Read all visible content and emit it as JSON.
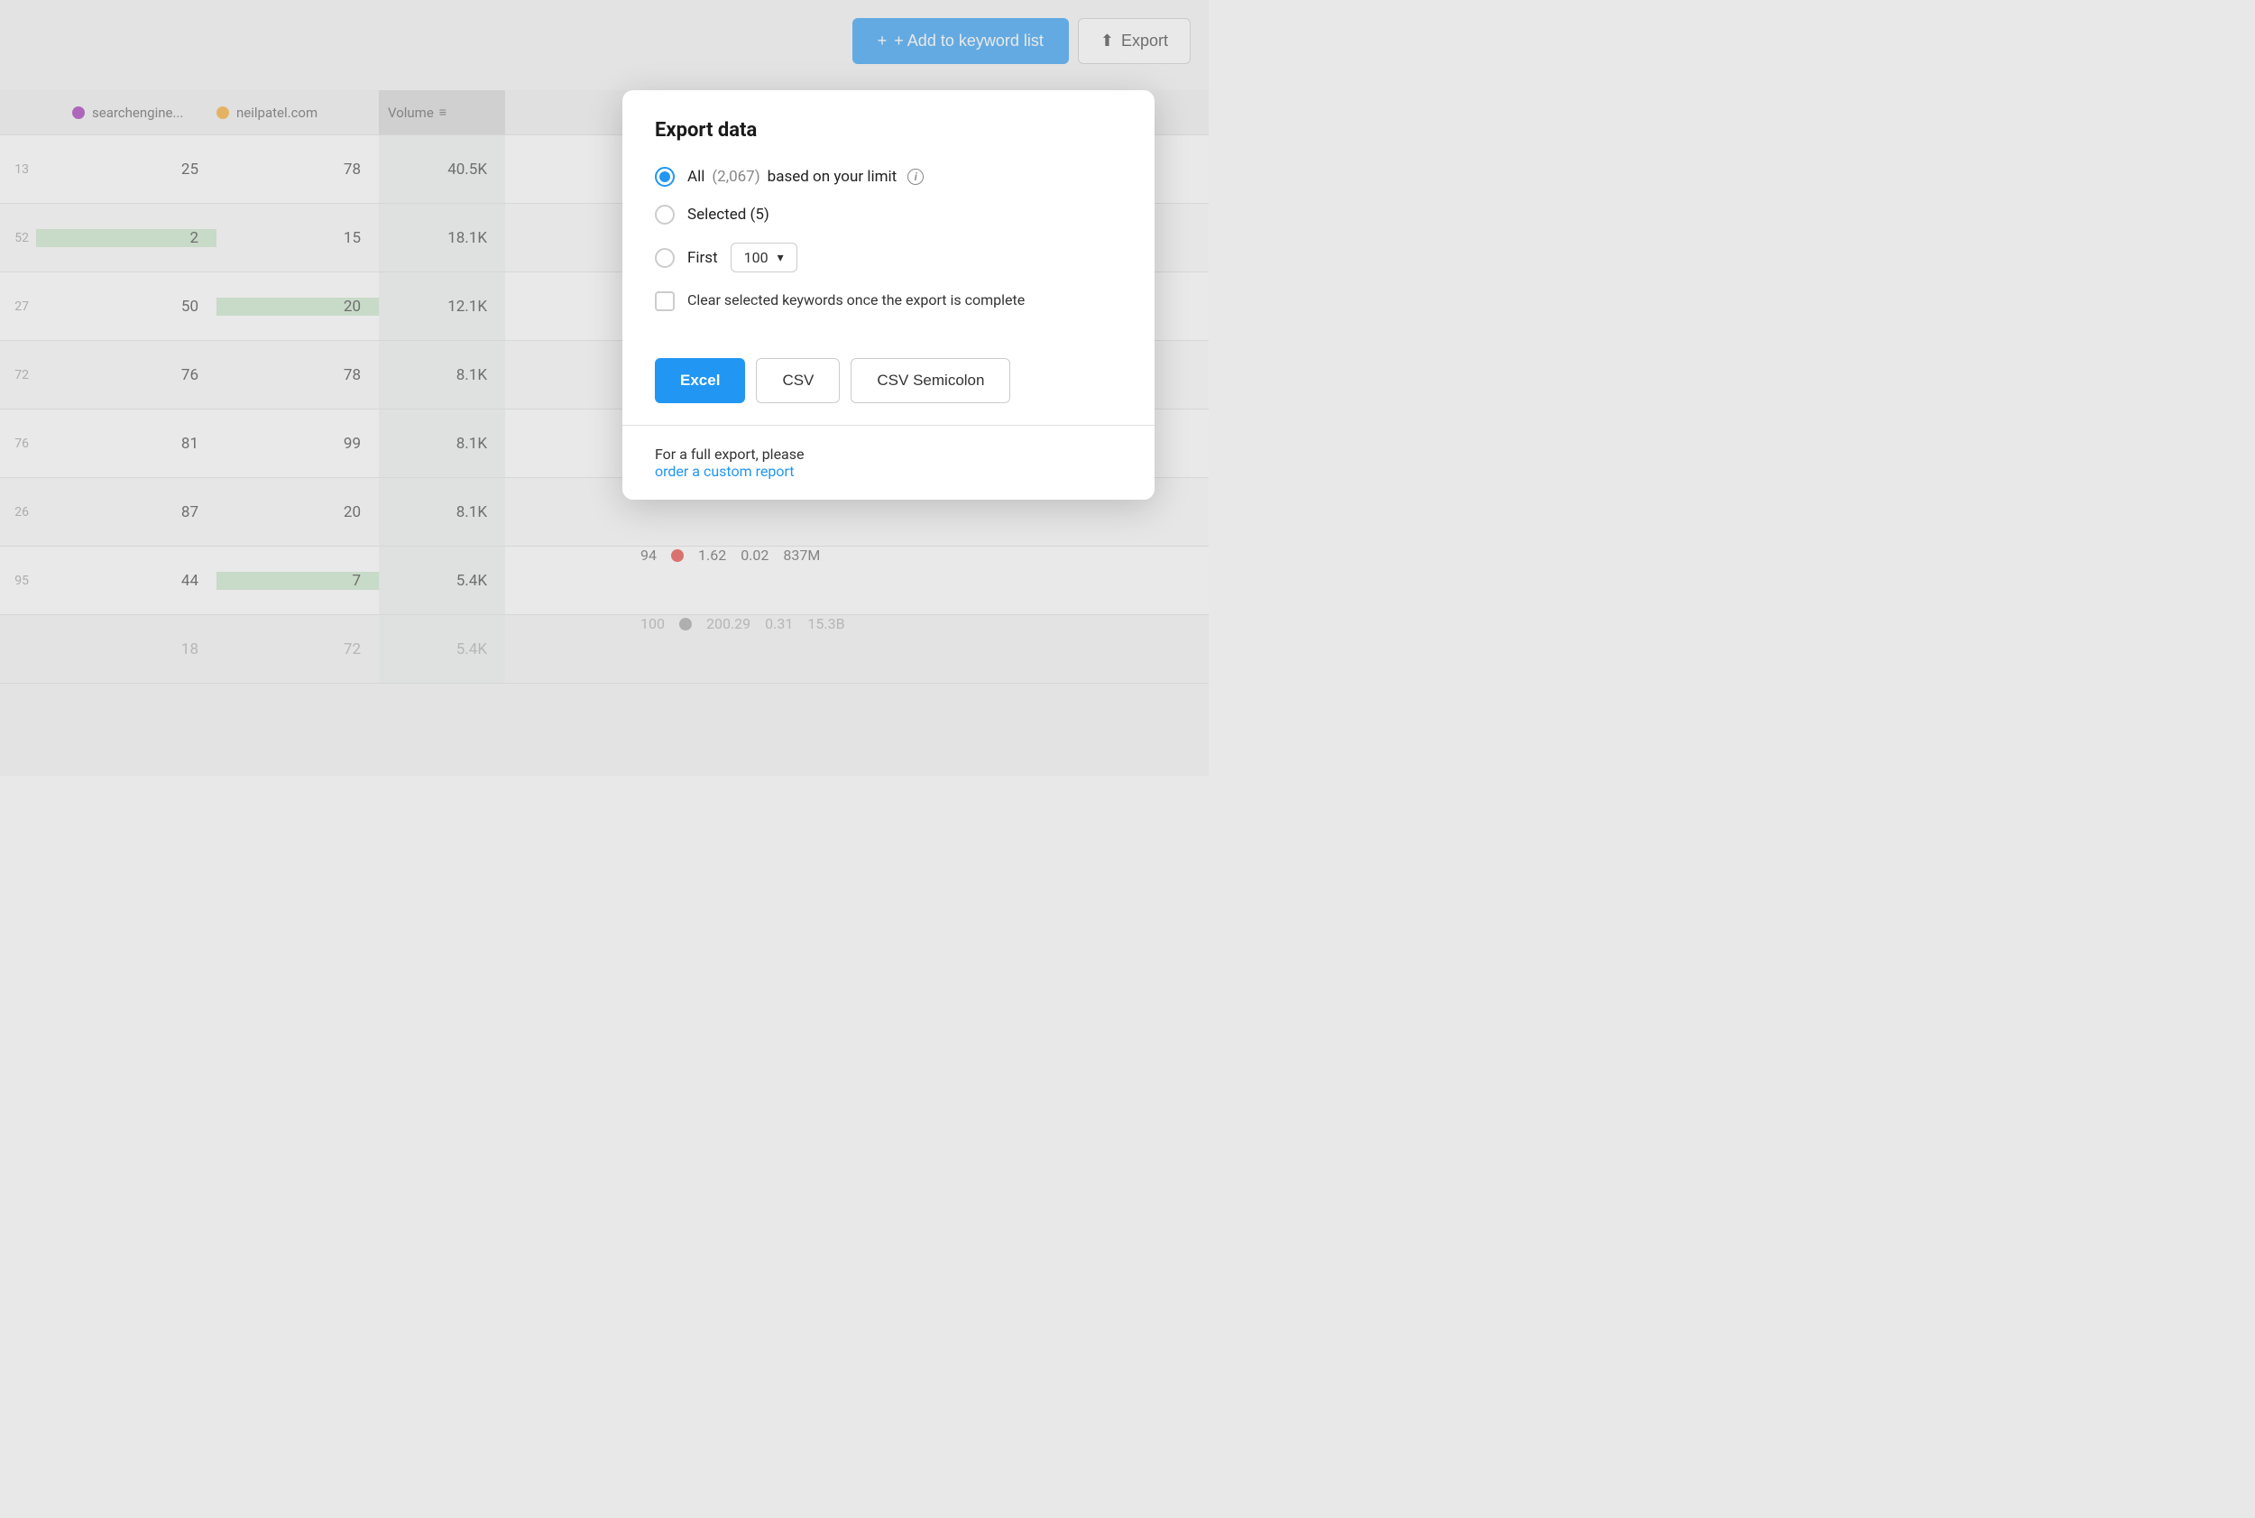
{
  "toolbar": {
    "add_keyword_label": "+ Add to keyword list",
    "export_label": "Export"
  },
  "table": {
    "columns": {
      "searchengine_label": "searchengine...",
      "neilpatel_label": "neilpatel.com",
      "volume_label": "Volume"
    },
    "rows": [
      {
        "num": "13",
        "se_val": "25",
        "np_val": "78",
        "vol": "40.5K",
        "se_highlight": false,
        "np_highlight": false
      },
      {
        "num": "52",
        "se_val": "2",
        "np_val": "15",
        "vol": "18.1K",
        "se_highlight": true,
        "np_highlight": false
      },
      {
        "num": "27",
        "se_val": "50",
        "np_val": "20",
        "vol": "12.1K",
        "se_highlight": false,
        "np_highlight": true
      },
      {
        "num": "72",
        "se_val": "76",
        "np_val": "78",
        "vol": "8.1K",
        "se_highlight": false,
        "np_highlight": false
      },
      {
        "num": "76",
        "se_val": "81",
        "np_val": "99",
        "vol": "8.1K",
        "se_highlight": false,
        "np_highlight": false
      },
      {
        "num": "26",
        "se_val": "87",
        "np_val": "20",
        "vol": "8.1K",
        "se_highlight": false,
        "np_highlight": false
      },
      {
        "num": "95",
        "se_val": "44",
        "np_val": "7",
        "vol": "5.4K",
        "se_highlight": false,
        "np_highlight": true
      }
    ],
    "footer_row": {
      "num": "",
      "se_val": "18",
      "np_val": "72",
      "vol": "5.4K"
    }
  },
  "extra_cols": {
    "rows": [
      {
        "v1": "",
        "dot": "",
        "v2": "",
        "v3": "",
        "v4": ""
      },
      {
        "v1": "",
        "dot": "",
        "v2": "",
        "v3": "",
        "v4": ""
      },
      {
        "v1": "",
        "dot": "",
        "v2": "",
        "v3": "",
        "v4": ""
      },
      {
        "v1": "",
        "dot": "",
        "v2": "",
        "v3": "",
        "v4": ""
      },
      {
        "v1": "",
        "dot": "",
        "v2": "",
        "v3": "",
        "v4": ""
      },
      {
        "v1": "",
        "dot": "",
        "v2": "",
        "v3": "",
        "v4": ""
      },
      {
        "v1": "94",
        "dot": "red",
        "v2": "1.62",
        "v3": "0.02",
        "v4": "837M"
      }
    ],
    "footer": {
      "v1": "100",
      "dot": "gray",
      "v2": "200.29",
      "v3": "0.31",
      "v4": "15.3B"
    }
  },
  "dialog": {
    "title": "Export data",
    "option_all_label": "All",
    "option_all_count": "(2,067)",
    "option_all_suffix": "based on your limit",
    "option_selected_label": "Selected (5)",
    "option_first_label": "First",
    "option_first_value": "100",
    "checkbox_label": "Clear selected keywords once the export is complete",
    "excel_label": "Excel",
    "csv_label": "CSV",
    "csv_semicolon_label": "CSV Semicolon",
    "footer_text": "For a full export, please",
    "footer_link": "order a custom report"
  }
}
